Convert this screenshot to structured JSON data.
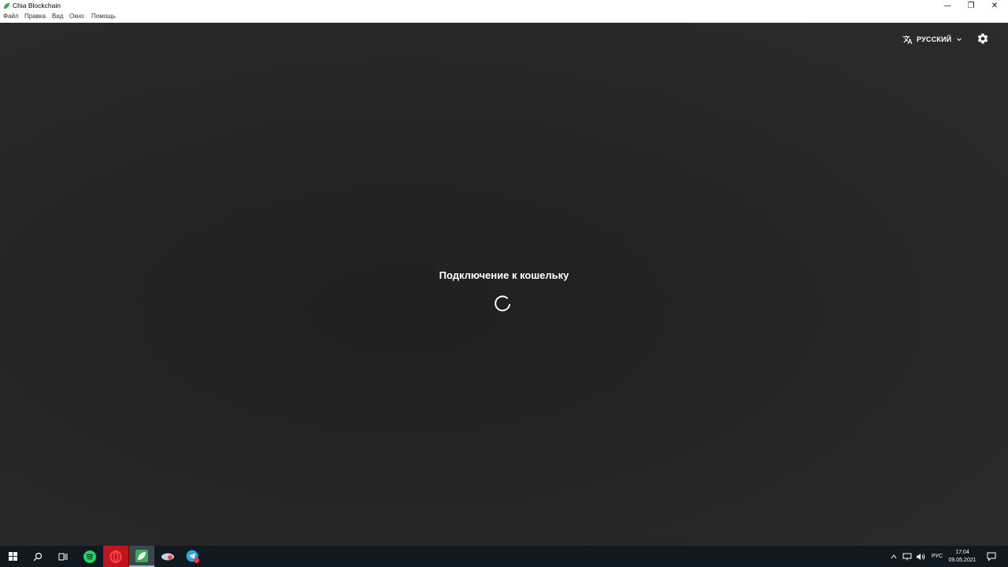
{
  "window": {
    "title": "Chia Blockchain",
    "controls": {
      "minimize": "—",
      "restore": "❐",
      "close": "✕"
    }
  },
  "menu": {
    "items": [
      {
        "label": "Файл"
      },
      {
        "label": "Правка"
      },
      {
        "label": "Вид"
      },
      {
        "label": "Окно"
      },
      {
        "label": "Помощь"
      }
    ]
  },
  "header": {
    "language": {
      "label": "РУССКИЙ",
      "icon": "translate-icon"
    },
    "settings_icon": "gear-icon"
  },
  "main": {
    "status": "Подключение к кошельку"
  },
  "taskbar": {
    "apps": [
      {
        "name": "start-button"
      },
      {
        "name": "search-button"
      },
      {
        "name": "task-view-button"
      },
      {
        "name": "spotify-button"
      },
      {
        "name": "opera-button"
      },
      {
        "name": "chia-button"
      },
      {
        "name": "app-button"
      },
      {
        "name": "telegram-button"
      }
    ],
    "tray": {
      "language": "РУС",
      "time": "17:04",
      "date": "09.05.2021"
    }
  },
  "colors": {
    "accent_green": "#3aac59",
    "background": "#262626",
    "taskbar": "#101820"
  }
}
